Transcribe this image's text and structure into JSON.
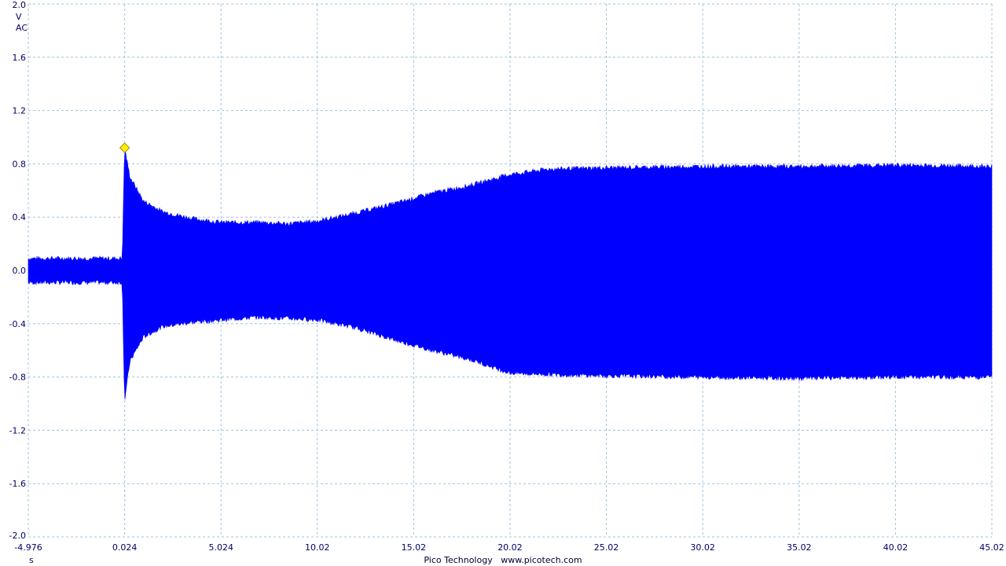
{
  "chart_data": {
    "type": "line",
    "y_axis": {
      "unit": "V",
      "coupling": "AC",
      "ylim": [
        -2.0,
        2.0
      ],
      "ticks": [
        "2.0",
        "1.6",
        "1.2",
        "0.8",
        "0.4",
        "0.0",
        "-0.4",
        "-0.8",
        "-1.2",
        "-1.6",
        "-2.0"
      ]
    },
    "x_axis": {
      "unit": "s",
      "xlim": [
        -4.976,
        45.02
      ],
      "ticks": [
        "-4.976",
        "0.024",
        "5.024",
        "10.02",
        "15.02",
        "20.02",
        "25.02",
        "30.02",
        "35.02",
        "40.02",
        "45.02"
      ]
    },
    "grid": true,
    "trigger_marker": {
      "x": 0.024,
      "y": 0.92,
      "color": "#ffee00"
    },
    "series_color": "#0000ff",
    "envelope": {
      "x": [
        -4.976,
        -0.1,
        0.02,
        0.3,
        1.0,
        2.0,
        3.5,
        5.024,
        7.0,
        8.5,
        10.02,
        12.0,
        14.0,
        16.0,
        18.0,
        20.02,
        22.0,
        25.02,
        30.02,
        35.02,
        40.02,
        45.02
      ],
      "upper": [
        0.09,
        0.09,
        0.92,
        0.7,
        0.52,
        0.44,
        0.39,
        0.36,
        0.36,
        0.35,
        0.37,
        0.43,
        0.5,
        0.58,
        0.64,
        0.72,
        0.76,
        0.77,
        0.78,
        0.78,
        0.79,
        0.78
      ],
      "lower": [
        -0.09,
        -0.09,
        -0.98,
        -0.68,
        -0.5,
        -0.42,
        -0.39,
        -0.37,
        -0.35,
        -0.36,
        -0.37,
        -0.43,
        -0.52,
        -0.6,
        -0.67,
        -0.77,
        -0.78,
        -0.79,
        -0.8,
        -0.81,
        -0.8,
        -0.8
      ]
    }
  },
  "footer": {
    "brand": "Pico Technology",
    "url": "www.picotech.com"
  }
}
